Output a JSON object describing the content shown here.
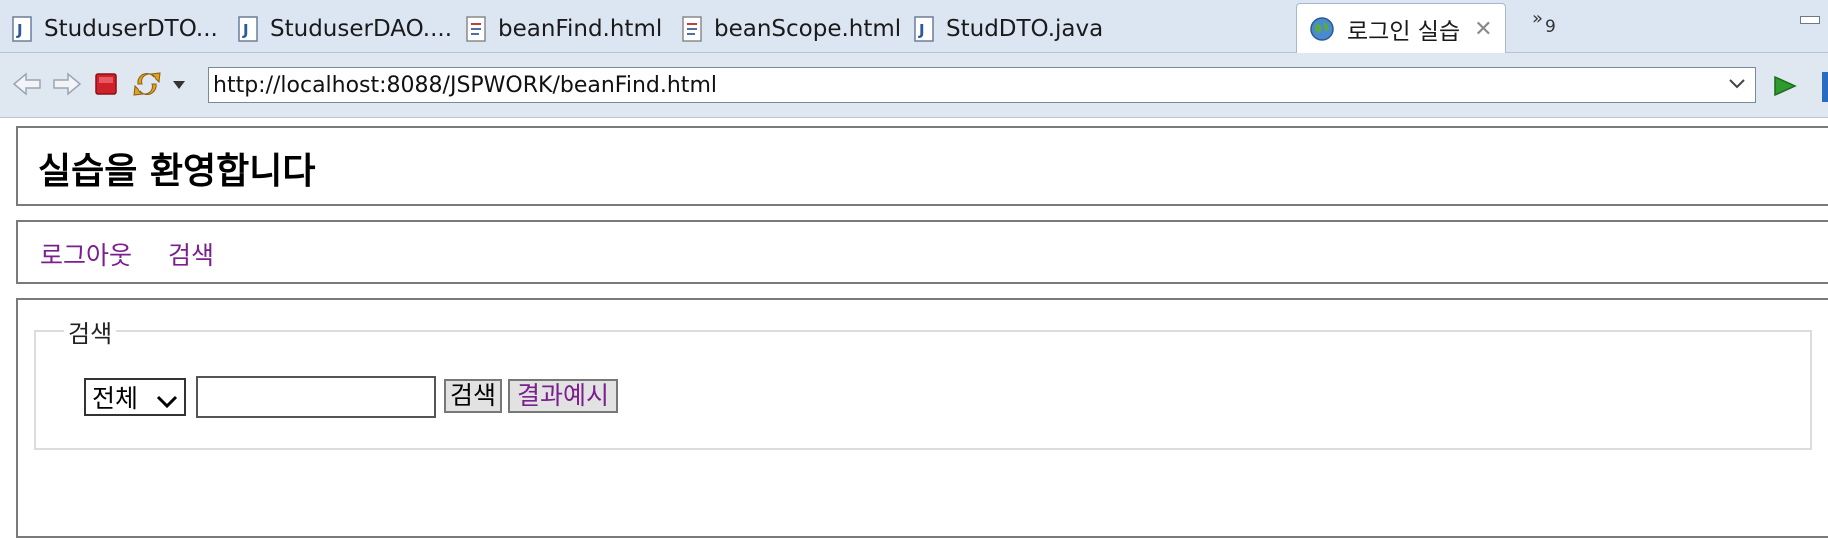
{
  "tabs": [
    {
      "label": "StuduserDTO...",
      "icon": "java-file-icon"
    },
    {
      "label": "StuduserDAO....",
      "icon": "java-file-icon"
    },
    {
      "label": "beanFind.html",
      "icon": "html-file-icon"
    },
    {
      "label": "beanScope.html",
      "icon": "html-file-icon"
    },
    {
      "label": "StudDTO.java",
      "icon": "java-file-icon"
    },
    {
      "label": "로그인 실습",
      "icon": "globe-icon",
      "active": true
    }
  ],
  "tab_overflow": {
    "symbol": "»",
    "count": "9"
  },
  "toolbar": {
    "url": "http://localhost:8088/JSPWORK/beanFind.html"
  },
  "page": {
    "title": "실습을 환영합니다",
    "nav": [
      "로그아웃",
      "검색"
    ],
    "search": {
      "legend": "검색",
      "select_value": "전체",
      "input_value": "",
      "search_button": "검색",
      "example_button": "결과예시"
    }
  },
  "colors": {
    "link": "#7a1f8e",
    "tabbar_bg": "#dce6f2",
    "toolbar_bg": "#dfe7f1",
    "stop": "#d0202a",
    "go": "#2f9a2f"
  }
}
